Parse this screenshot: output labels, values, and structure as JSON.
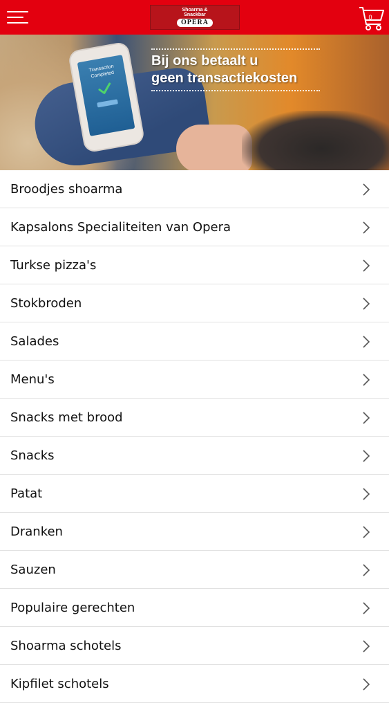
{
  "header": {
    "logo_sub": "Shoarma & Snackbar",
    "logo_main": "OPERA",
    "cart_count": "0",
    "brand_color": "#e3000f"
  },
  "banner": {
    "phone_text": "Transaction Completed",
    "headline_line1": "Bij ons betaalt u",
    "headline_line2": "geen transactiekosten"
  },
  "menu": {
    "items": [
      {
        "label": "Broodjes shoarma"
      },
      {
        "label": "Kapsalons Specialiteiten van Opera"
      },
      {
        "label": "Turkse pizza's"
      },
      {
        "label": "Stokbroden"
      },
      {
        "label": "Salades"
      },
      {
        "label": "Menu's"
      },
      {
        "label": "Snacks met brood"
      },
      {
        "label": "Snacks"
      },
      {
        "label": "Patat"
      },
      {
        "label": "Dranken"
      },
      {
        "label": "Sauzen"
      },
      {
        "label": "Populaire gerechten"
      },
      {
        "label": "Shoarma schotels"
      },
      {
        "label": "Kipfilet schotels"
      }
    ]
  }
}
